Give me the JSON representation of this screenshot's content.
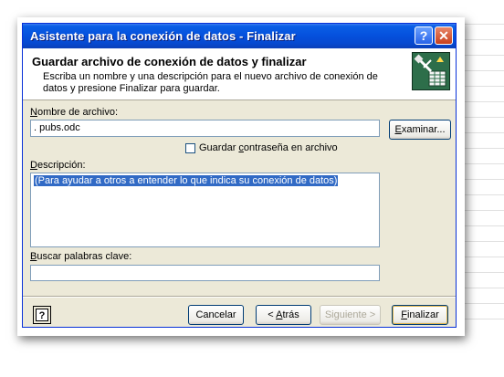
{
  "window": {
    "title": "Asistente para la conexión de datos - Finalizar",
    "help_symbol": "?",
    "close_symbol": "✕"
  },
  "header": {
    "title": "Guardar archivo de conexión de datos y finalizar",
    "description": "Escriba un nombre y una descripción para el nuevo archivo de conexión de datos y presione Finalizar para guardar.",
    "icon": "data-connection-wizard-icon"
  },
  "file_name": {
    "label_mnemonic": "N",
    "label_rest": "ombre de archivo:",
    "value": ". pubs.odc",
    "browse_mnemonic": "E",
    "browse_rest": "xaminar..."
  },
  "save_password": {
    "label_before": "Guardar ",
    "label_mnemonic": "c",
    "label_after": "ontraseña en archivo",
    "checked": false
  },
  "description": {
    "label_mnemonic": "D",
    "label_rest": "escripción:",
    "value": "(Para ayudar a otros a entender lo que indica su conexión de datos)"
  },
  "keywords": {
    "label_mnemonic": "B",
    "label_rest": "uscar palabras clave:",
    "value": ""
  },
  "footer": {
    "cancel": "Cancelar",
    "back_prefix": "< ",
    "back_mnemonic": "A",
    "back_rest": "trás",
    "next": "Siguiente >",
    "finish_mnemonic": "F",
    "finish_rest": "inalizar"
  },
  "colors": {
    "titlebar": "#0550dc",
    "selection": "#316ac5",
    "dialog_bg": "#ece9d8"
  }
}
